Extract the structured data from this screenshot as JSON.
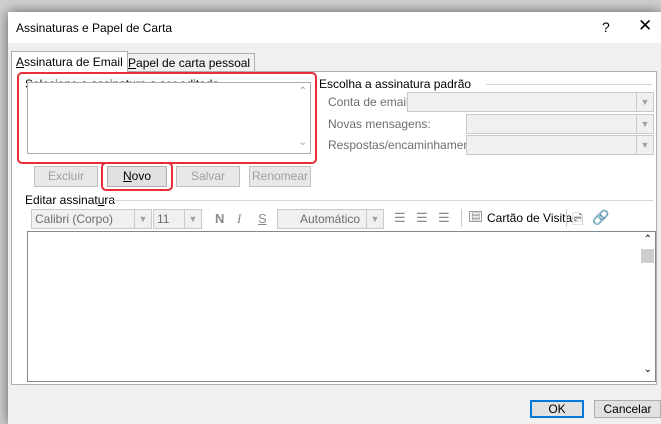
{
  "window": {
    "title": "Assinaturas e Papel de Carta",
    "help": "?",
    "close": "✕"
  },
  "tabs": [
    {
      "label_pre": "",
      "label_acc": "A",
      "label_post": "ssinatura de Email"
    },
    {
      "label_pre": "",
      "label_acc": "P",
      "label_post": "apel de carta pessoal"
    }
  ],
  "select_group": {
    "label_pre": "Selecione a assinatura a ser e",
    "label_acc": "d",
    "label_post": "itada"
  },
  "default_group": {
    "label": "Escolha a assinatura padrão",
    "email_account": "Conta de email:",
    "new_messages": "Novas mensagens:",
    "replies": "Respostas/encaminhamentos:"
  },
  "buttons": {
    "delete": "Excluir",
    "new_acc": "N",
    "new_post": "ovo",
    "save": "Salvar",
    "rename": "Renomear"
  },
  "edit_group": {
    "label_pre": "Editar assinat",
    "label_acc": "u",
    "label_post": "ra"
  },
  "toolbar": {
    "font": "Calibri (Corpo)",
    "size": "11",
    "bold": "N",
    "italic": "I",
    "underline": "S",
    "color": "Automático",
    "business_card": "Cartão de Visita"
  },
  "footer": {
    "ok": "OK",
    "cancel": "Cancelar"
  },
  "colors": {
    "highlight": "#e52e38",
    "accent": "#0078d7"
  }
}
